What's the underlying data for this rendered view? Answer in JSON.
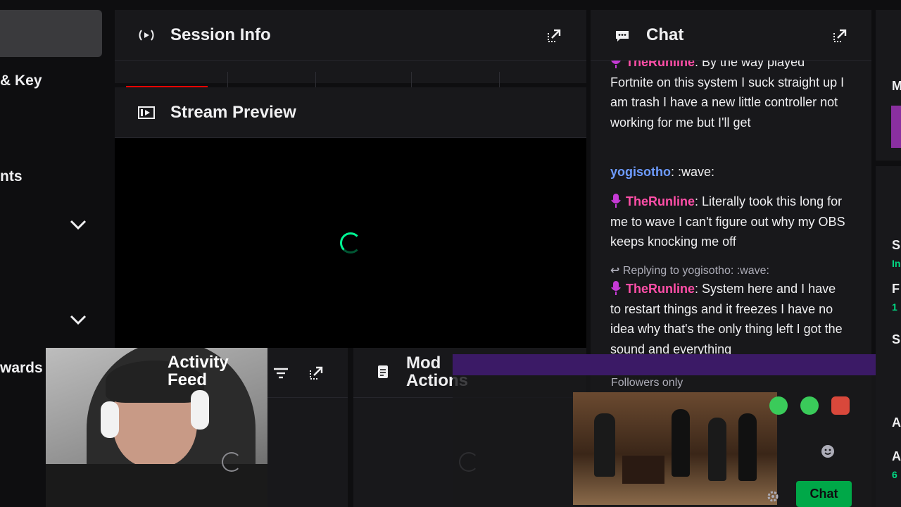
{
  "nav": {
    "key_label": "& Key",
    "ents_label": "nts",
    "rewards_label": "wards"
  },
  "session": {
    "title": "Session Info"
  },
  "preview": {
    "title": "Stream Preview"
  },
  "activity": {
    "title_line1": "Activity",
    "title_line2": "Feed"
  },
  "mod": {
    "title_line1": "Mod",
    "title_line2": "Actions"
  },
  "chat": {
    "title": "Chat",
    "messages": [
      {
        "user": "TheRunline",
        "text": ": By the way played Fortnite on this system I suck straight up I am trash I have a new little controller not working for me but I'll get",
        "color": "#ff4fa8"
      },
      {
        "user": "yogisotho",
        "text": ": :wave:",
        "color": "#6e9cff"
      },
      {
        "user": "TheRunline",
        "text": ": Literally took this long for me to wave I can't figure out why my OBS keeps knocking me off",
        "color": "#ff4fa8"
      },
      {
        "user": "TheRunline",
        "text": ": System here and I have to restart things and it freezes I have no idea why that's the only thing left I got the sound and everything",
        "color": "#ff4fa8"
      }
    ],
    "reply_note": "Replying to yogisotho: :wave:",
    "followers_only": "Followers only",
    "send_label": "Chat"
  },
  "right_strip": {
    "letters": [
      "M",
      "S",
      "F",
      "S",
      "A",
      "A"
    ],
    "sub": [
      "In",
      "1",
      "6"
    ]
  },
  "colors": {
    "accent": "#00a848",
    "brand_purple": "#9147ff",
    "live_red": "#eb0400"
  }
}
